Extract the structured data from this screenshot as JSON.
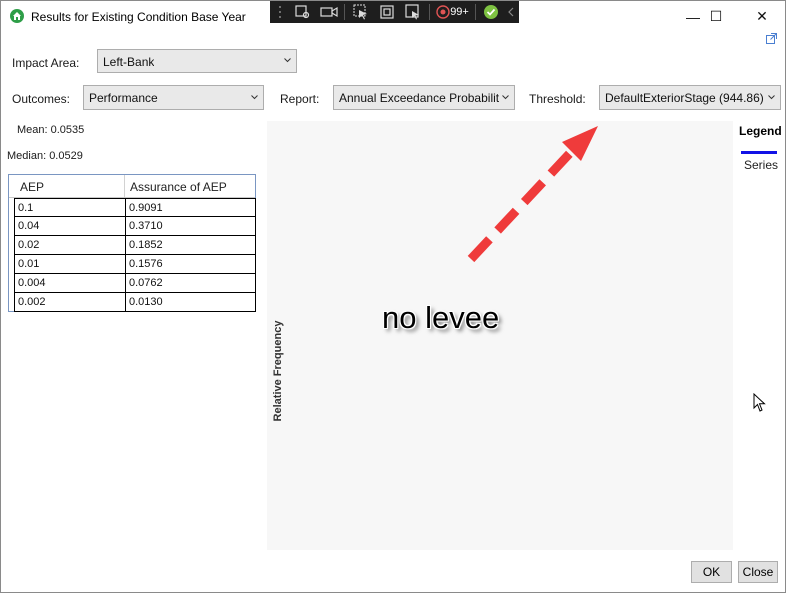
{
  "window": {
    "title": "Results for Existing Condition Base Year",
    "minimize_glyph": "—",
    "maximize_glyph": "☐",
    "close_glyph": "✕"
  },
  "debug_toolbar": {
    "badge": "99+"
  },
  "impact_area": {
    "label": "Impact Area:",
    "value": "Left-Bank"
  },
  "outcomes": {
    "label": "Outcomes:",
    "value": "Performance"
  },
  "report": {
    "label": "Report:",
    "value": "Annual Exceedance Probabilit"
  },
  "threshold": {
    "label": "Threshold:",
    "value": "DefaultExteriorStage (944.86)"
  },
  "stats": {
    "mean": "Mean: 0.0535",
    "median": "Median: 0.0529"
  },
  "table": {
    "headers": [
      "AEP",
      "Assurance of AEP"
    ],
    "rows": [
      [
        "0.1",
        "0.9091"
      ],
      [
        "0.04",
        "0.3710"
      ],
      [
        "0.02",
        "0.1852"
      ],
      [
        "0.01",
        "0.1576"
      ],
      [
        "0.004",
        "0.0762"
      ],
      [
        "0.002",
        "0.0130"
      ]
    ]
  },
  "chart": {
    "ylabel": "Relative Frequency",
    "legend_title": "Legend",
    "legend_series": "Series",
    "series_color": "#1212e6"
  },
  "annotation": {
    "text": "no levee",
    "arrow_color": "#ef3b3b"
  },
  "buttons": {
    "ok": "OK",
    "close": "Close"
  }
}
